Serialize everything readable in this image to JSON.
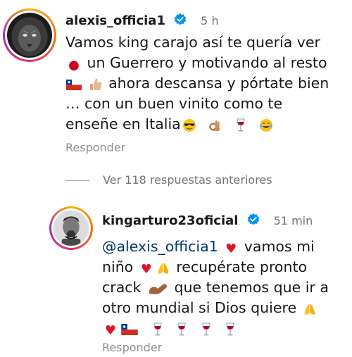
{
  "comment1": {
    "username": "alexis_officia1",
    "time": "5 h",
    "lines": [
      "Vamos king carajo así te quería  ver",
      "un Guerrero y motivando al resto",
      "ahora descansa y pórtate bien",
      "… con un buen vinito como te",
      "enseñe  en Italia"
    ],
    "reply_label": "Responder"
  },
  "view_replies": {
    "label": "Ver 118 respuestas anteriores"
  },
  "comment2": {
    "username": "kingarturo23oficial",
    "time": "51 min",
    "mention": "@alexis_officia1",
    "lines": [
      "vamos mi",
      "niño",
      "recupérate pronto",
      "crack",
      "que tenemos que ir a",
      "otro mundial si Dios quiere"
    ],
    "reply_label": "Responder"
  },
  "icons": {
    "verified": "verified-badge-icon",
    "blood_drop": "blood-drop-icon",
    "chile_flag": "chile-flag-icon",
    "thumbs_up": "thumbs-up-icon",
    "sunglasses": "sunglasses-face-icon",
    "ok_hand": "ok-hand-icon",
    "wine_glass": "wine-glass-icon",
    "laughing": "tears-of-joy-icon",
    "red_heart": "red-heart-icon",
    "praying_hands": "folded-hands-icon",
    "flexed_bicep": "flexed-bicep-icon"
  },
  "colors": {
    "verified_blue": "#0095f6",
    "mention_blue": "#00376b",
    "muted_text": "#737373",
    "reply_text": "#8e8e8e"
  }
}
